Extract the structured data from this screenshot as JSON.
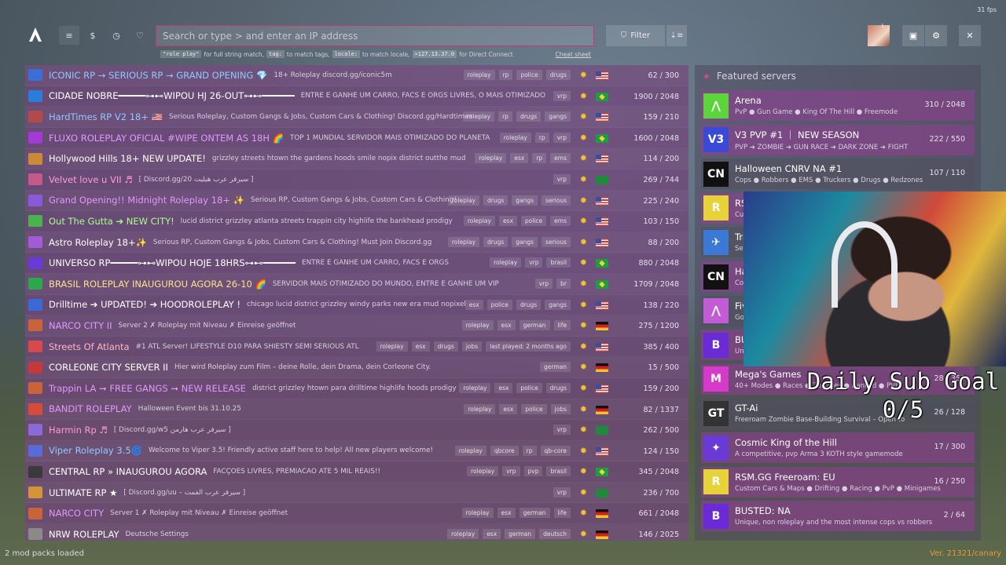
{
  "fps": "31 fps",
  "search": {
    "placeholder": "Search or type > and enter an IP address"
  },
  "hints": {
    "code1": "\"role play\"",
    "text1": "for full string match,",
    "code2": "tag:",
    "text2": "to match tags,",
    "code3": "locale:",
    "text3": "to match locale,",
    "code4": ">127.13.37.0",
    "text4": "for Direct Connect",
    "cheat": "Cheat sheet"
  },
  "toolbar": {
    "filter_label": "Filter",
    "avatar_badge": "1"
  },
  "servers": [
    {
      "name": "ICONIC RP → SERIOUS RP → GRAND OPENING 💎",
      "color": "#8fc8ff",
      "desc": "18+ Roleplay discord.gg/iconic5m",
      "tags": [
        "roleplay",
        "rp",
        "police",
        "drugs"
      ],
      "flag": "us",
      "players": "62 / 300",
      "icon": "#3c6fd6"
    },
    {
      "name": "CIDADE NOBRE━━━━━⊶⊷WIPOU HJ 26-OUT⊶⊷━━━━━━",
      "color": "#ffffff",
      "desc": "ENTRE E GANHE UM CARRO, FACS E ORGS LIVRES, O MAIS OTIMIZADO",
      "tags": [
        "vrp"
      ],
      "flag": "br",
      "players": "1900 / 2048",
      "icon": "#2a7ed8"
    },
    {
      "name": "HardTimes RP V2 18+ 🇺🇸",
      "color": "#8fc8ff",
      "desc": "Serious Roleplay, Custom Gangs & Jobs, Custom Cars & Clothing! Discord.gg/Hardtimes",
      "tags": [
        "roleplay",
        "rp",
        "drugs",
        "gangs"
      ],
      "flag": "us",
      "players": "159 / 210",
      "icon": "#b34a4a"
    },
    {
      "name": "FLUXO ROLEPLAY OFICIAL #WIPE ONTEM AS 18H 🌈",
      "color": "#e296ff",
      "desc": "TOP 1 MUNDIAL SERVIDOR MAIS OTIMIZADO DO PLANETA",
      "tags": [
        "roleplay",
        "rp",
        "vrp"
      ],
      "flag": "br",
      "players": "1600 / 2048",
      "icon": "#a33ad6"
    },
    {
      "name": "Hollywood Hills 18+ NEW UPDATE!",
      "color": "#ffffff",
      "desc": "grizzley streets htown the gardens hoods smile nopix district outthe mud",
      "tags": [
        "roleplay",
        "esx",
        "rp",
        "ems"
      ],
      "flag": "us",
      "players": "114 / 200",
      "icon": "#c98a3a"
    },
    {
      "name": "Velvet love u VII ♬",
      "color": "#ff9ad8",
      "desc": "[ Discord.gg/20 سيرفر عرب هيليت ]",
      "tags": [
        "vrp"
      ],
      "flag": "sa",
      "players": "269 / 744",
      "icon": "#c35a8a"
    },
    {
      "name": "Grand Opening!! Midnight Roleplay 18+ ✨",
      "color": "#e296ff",
      "desc": "Serious RP, Custom Gangs & Jobs, Custom Cars & Clothing!",
      "tags": [
        "roleplay",
        "drugs",
        "gangs",
        "serious"
      ],
      "flag": "us",
      "players": "225 / 240",
      "icon": "#8a5ad6"
    },
    {
      "name": "Out The Gutta ➔ NEW CITY!",
      "color": "#a8ff8a",
      "desc": "lucid district grizzley atlanta streets trappin city highlife the bankhead prodigy",
      "tags": [
        "roleplay",
        "esx",
        "police",
        "ems"
      ],
      "flag": "us",
      "players": "103 / 150",
      "icon": "#4ab34a"
    },
    {
      "name": "Astro Roleplay 18+✨",
      "color": "#ffffff",
      "desc": "Serious RP, Custom Gangs & Jobs, Custom Cars & Clothing! Must Join Discord.gg",
      "tags": [
        "roleplay",
        "drugs",
        "gangs",
        "serious"
      ],
      "flag": "us",
      "players": "88 / 200",
      "icon": "#a35ad6"
    },
    {
      "name": "UNIVERSO RP━━━━━⊶⊷WIPOU HOJE 18HRS⊶⊷━━━━━━",
      "color": "#ffffff",
      "desc": "ENTRE E GANHE UM CARRO, FACS E ORGS",
      "tags": [
        "roleplay",
        "vrp",
        "brasil"
      ],
      "flag": "br",
      "players": "880 / 2048",
      "icon": "#6a3ad6"
    },
    {
      "name": "BRASIL ROLEPLAY INAUGUROU AGORA 26-10 🌈",
      "color": "#ffe08a",
      "desc": "SERVIDOR MAIS OTIMIZADO DO MUNDO, ENTRE E GANHE UM VIP",
      "tags": [
        "vrp",
        "br"
      ],
      "flag": "br",
      "players": "1709 / 2048",
      "icon": "#2aa84a"
    },
    {
      "name": "Drilltime ➔ UPDATED! ➔ HOODROLEPLAY !",
      "color": "#ffffff",
      "desc": "chicago lucid district grizzley windy parks new era mud nopixel",
      "tags": [
        "esx",
        "police",
        "drugs",
        "gangs"
      ],
      "flag": "us",
      "players": "138 / 220",
      "icon": "#3a6ad6"
    },
    {
      "name": "NARCO CITY II",
      "color": "#e296ff",
      "desc": "Server 2 ✗ Roleplay mit Niveau ✗ Einreise geöffnet",
      "tags": [
        "roleplay",
        "esx",
        "german",
        "life"
      ],
      "flag": "de",
      "players": "275 / 1200",
      "icon": "#c9643a"
    },
    {
      "name": "Streets Of Atlanta",
      "color": "#ffb3c8",
      "desc": "#1 ATL Server! LIFESTYLE D10 PARA SHIESTY SEMI SERIOUS ATL",
      "tags": [
        "roleplay",
        "esx",
        "drugs",
        "jobs",
        "last played: 2 months ago"
      ],
      "flag": "us",
      "players": "385 / 400",
      "icon": "#d64a4a"
    },
    {
      "name": "CORLEONE CITY SERVER II",
      "color": "#ffffff",
      "desc": "Hier wird Roleplay zum Film – deine Rolle, dein Drama, dein Corleone City.",
      "tags": [
        "german"
      ],
      "flag": "de",
      "players": "15 / 500",
      "icon": "#c33a3a"
    },
    {
      "name": "Trappin LA ➞ FREE GANGS ➞ NEW RELEASE",
      "color": "#e296ff",
      "desc": "district grizzley htown para drilltime highlife hoods prodigy",
      "tags": [
        "roleplay",
        "esx",
        "police",
        "drugs"
      ],
      "flag": "us",
      "players": "159 / 200",
      "icon": "#c9643a"
    },
    {
      "name": "BANDIT ROLEPLAY",
      "color": "#e296ff",
      "desc": "Halloween Event bis 31.10.25",
      "tags": [
        "roleplay",
        "esx",
        "police",
        "jobs"
      ],
      "flag": "de",
      "players": "82 / 1337",
      "icon": "#d64a3a"
    },
    {
      "name": "Harmin Rp ♬",
      "color": "#ff9ad8",
      "desc": "[ Discord.gg/w5 سيرفر عرب هارمن ]",
      "tags": [
        "vrp"
      ],
      "flag": "sa",
      "players": "262 / 500",
      "icon": "#8a6ad6"
    },
    {
      "name": "Viper Roleplay 3.5🌀",
      "color": "#8fc8ff",
      "desc": "Welcome to Viper 3.5! Friendly active staff here to help! All new players welcome!",
      "tags": [
        "roleplay",
        "qbcore",
        "rp",
        "qb-core"
      ],
      "flag": "us",
      "players": "124 / 150",
      "icon": "#5a6ad6"
    },
    {
      "name": "CENTRAL RP » INAUGUROU AGORA",
      "color": "#ffffff",
      "desc": "FACÇOES LIVRES, PREMIACAO ATE 5 MIL REAIS!!",
      "tags": [
        "roleplay",
        "vrp",
        "pvp",
        "brasil"
      ],
      "flag": "br",
      "players": "345 / 2048",
      "icon": "#3a3a3a"
    },
    {
      "name": "ULTIMATE RP ★",
      "color": "#ffffff",
      "desc": "[ Discord.gg/uu – سيرفر عرب الفمت ]",
      "tags": [
        "vrp"
      ],
      "flag": "sa",
      "players": "236 / 700",
      "icon": "#d6943a"
    },
    {
      "name": "NARCO CITY",
      "color": "#e296ff",
      "desc": "Server 1 ✗ Roleplay mit Niveau ✗ Einreise geöffnet",
      "tags": [
        "roleplay",
        "esx",
        "german",
        "life"
      ],
      "flag": "de",
      "players": "661 / 2048",
      "icon": "#c9643a"
    },
    {
      "name": "NRW ROLEPLAY",
      "color": "#ffffff",
      "desc": "Deutsche Settings",
      "tags": [
        "roleplay",
        "esx",
        "german",
        "deutsch"
      ],
      "flag": "de",
      "players": "146 / 2025",
      "icon": "#8a8a8a"
    }
  ],
  "featured": {
    "title": "Featured servers",
    "cards": [
      {
        "name": "Arena",
        "desc": "PvP ● Gun Game ● King Of The Hill ● Freemode",
        "players": "310 / 2048",
        "icon": "#5ad63a",
        "glyph": "⋀",
        "dark": false
      },
      {
        "name": "V3 PVP #1 ｜ NEW SEASON",
        "desc": "PVP ➔ ZOMBIE ➔ GUN RACE ➔ DARK ZONE ➔ FIGHT",
        "players": "222 / 550",
        "icon": "#3a4ad6",
        "glyph": "V3",
        "dark": false
      },
      {
        "name": "Halloween CNRV NA #1",
        "desc": "Cops ● Robbers ● EMS ● Truckers ● Drugs ● Redzones",
        "players": "107 / 110",
        "icon": "#111111",
        "glyph": "CN",
        "dark": true
      },
      {
        "name": "RSM",
        "desc": "Cu",
        "players": "",
        "icon": "#e8d23a",
        "glyph": "R",
        "dark": false
      },
      {
        "name": "Tra",
        "desc": "Se",
        "players": "",
        "icon": "#3a7ad6",
        "glyph": "✈",
        "dark": true
      },
      {
        "name": "Ha",
        "desc": "Co",
        "players": "",
        "icon": "#111111",
        "glyph": "CN",
        "dark": false
      },
      {
        "name": "Fiv",
        "desc": "Go",
        "players": "",
        "icon": "#c35ad6",
        "glyph": "⋀",
        "dark": true
      },
      {
        "name": "BU",
        "desc": "Un",
        "players": "",
        "icon": "#6a2ad6",
        "glyph": "B",
        "dark": false
      },
      {
        "name": "Mega's Games",
        "desc": "40+ Modes ● Races ● Zombies ● Ranked ● PVP",
        "players": "28 / 350",
        "icon": "#d63ac8",
        "glyph": "M",
        "dark": false
      },
      {
        "name": "GT-Ai",
        "desc": "Freeroam Zombie Base-Building Survival – Open to",
        "players": "26 / 128",
        "icon": "#333333",
        "glyph": "GT",
        "dark": true
      },
      {
        "name": "Cosmic King of the Hill",
        "desc": "A competitive, pvp Arma 3 KOTH style gamemode",
        "players": "17 / 300",
        "icon": "#6a3ad6",
        "glyph": "✦",
        "dark": false
      },
      {
        "name": "RSM.GG Freeroam: EU",
        "desc": "Custom Cars & Maps ● Drifting ● Racing ● PvP ● Minigames",
        "players": "16 / 250",
        "icon": "#e8d23a",
        "glyph": "R",
        "dark": false
      },
      {
        "name": "BUSTED: NA",
        "desc": "Unique, non roleplay and the most intense cops vs robbers",
        "players": "2 / 64",
        "icon": "#6a2ad6",
        "glyph": "B",
        "dark": false
      }
    ]
  },
  "overlay": {
    "goal_title": "Daily Sub Goal",
    "goal_value": "0/5"
  },
  "footer": {
    "left": "2 mod packs loaded",
    "right": "Ver. 21321/canary"
  }
}
